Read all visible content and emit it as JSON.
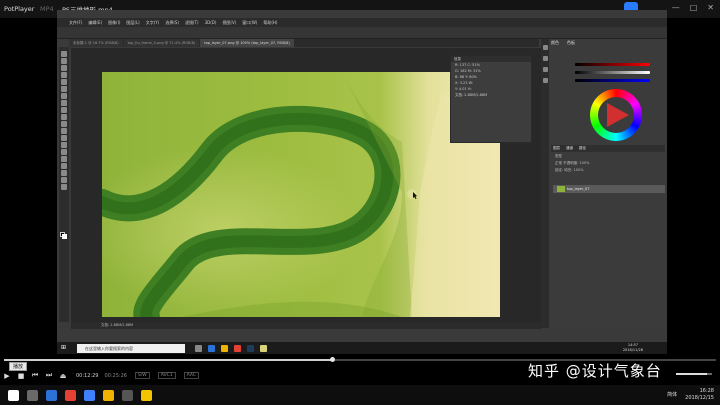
{
  "player": {
    "app_name": "PotPlayer",
    "separator": "MP4",
    "file_title": "PS三维地形.mp4",
    "window_buttons": [
      "—",
      "□",
      "✕"
    ],
    "seek_tooltip": "播放",
    "current_time": "00:12:29",
    "total_time": "00:25:26",
    "progress_fraction": 0.46,
    "formats": [
      "S/W",
      "AVC1",
      "AAC"
    ],
    "volume_fraction": 0.85
  },
  "photoshop": {
    "logo": "Ps",
    "menu": [
      "文件(F)",
      "编辑(E)",
      "图像(I)",
      "图层(L)",
      "文字(Y)",
      "选择(S)",
      "滤镜(T)",
      "3D(D)",
      "视图(V)",
      "窗口(W)",
      "帮助(H)"
    ],
    "tabs": [
      {
        "label": "未标题-1 @ 16.7% (RGB/8)",
        "active": false
      },
      {
        "label": "top_tlu_frame_0.png @ 71.4% (RGB/8)",
        "active": false
      },
      {
        "label": "top_layer_07.png @ 100% (top_layer_07, RGB/8)",
        "active": true
      }
    ],
    "info_panel": {
      "title": "信息",
      "rows": [
        "R:   137   C:  51%",
        "G:   162   M:  31%",
        "B:    68   Y:  80%",
        "X:  3.23   W:",
        "Y:  4.01   H:",
        "文档: 2.88M/2.88M"
      ]
    },
    "status": "文档: 2.88M/2.88M",
    "panel_tabs": [
      "颜色",
      "色板"
    ],
    "layers_tabs": [
      "图层",
      "通道",
      "路径"
    ],
    "layers_options": [
      "类型",
      "正常    不透明度: 100%",
      "锁定:      填充: 100%"
    ],
    "layer_name": "top_layer_07",
    "colors": {
      "red": "#d23030",
      "accent": "#47b7ff"
    }
  },
  "windows_inner": {
    "search_placeholder": "在这里输入你要搜索的内容",
    "clock_time": "14:57",
    "clock_date": "2018/11/28"
  },
  "watermark": "知乎 @设计气象台",
  "host_tray": {
    "ime": "简体",
    "time": "16:28",
    "date": "2018/12/15"
  }
}
